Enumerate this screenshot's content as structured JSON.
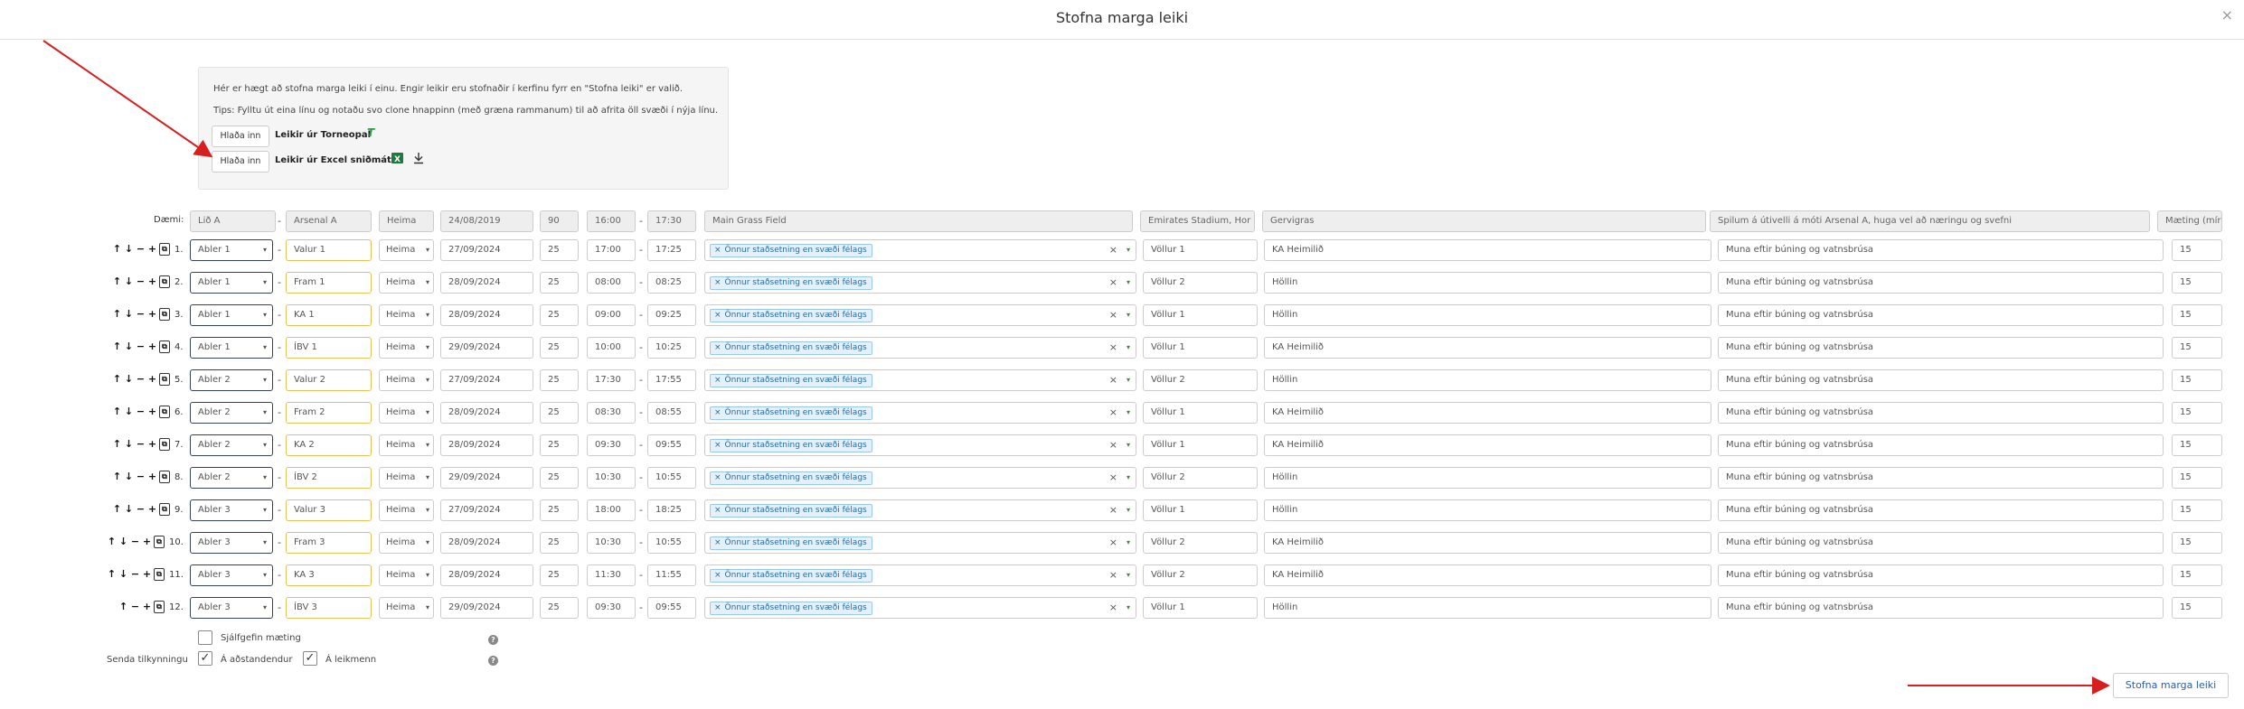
{
  "modal": {
    "title": "Stofna marga leiki",
    "close_icon": "×"
  },
  "info": {
    "line1": "Hér er hægt að stofna marga leiki í einu. Engir leikir eru stofnaðir í kerfinu fyrr en \"Stofna leiki\" er valið.",
    "line2": "Tips: Fylltu út eina línu og notaðu svo clone hnappinn (með græna rammanum) til að afrita öll svæði í nýja línu.",
    "load_button": "Hlaða inn",
    "load_torneopal": "Leikir úr Torneopal",
    "load_excel": "Leikir úr Excel sniðmáti",
    "torneopal_icon": "T",
    "excel_icon": "excel-icon",
    "download_icon": "download-icon"
  },
  "example": {
    "label": "Dæmi:",
    "team": "Lið A",
    "opponent": "Arsenal A",
    "venue": "Heima",
    "date": "24/08/2019",
    "duration": "90",
    "start": "16:00",
    "end": "17:30",
    "field": "Main Grass Field",
    "location": "Emirates Stadium, Hor",
    "surface": "Gervigras",
    "note": "Spilum á útivelli á móti Arsenal A, huga vel að næringu og svefni",
    "meet": "Mæting (mír"
  },
  "dash": "-",
  "field_tag": "Önnur staðsetning en svæði félags",
  "rows": [
    {
      "num": "1.",
      "team": "Abler 1",
      "opponent": "Valur 1",
      "venue": "Heima",
      "date": "27/09/2024",
      "duration": "25",
      "start": "17:00",
      "end": "17:25",
      "location": "Völlur 1",
      "surface": "KA Heimilið",
      "note": "Muna eftir búning og vatnsbrúsa",
      "meet": "15"
    },
    {
      "num": "2.",
      "team": "Abler 1",
      "opponent": "Fram 1",
      "venue": "Heima",
      "date": "28/09/2024",
      "duration": "25",
      "start": "08:00",
      "end": "08:25",
      "location": "Völlur 2",
      "surface": "Höllin",
      "note": "Muna eftir búning og vatnsbrúsa",
      "meet": "15"
    },
    {
      "num": "3.",
      "team": "Abler 1",
      "opponent": "KA 1",
      "venue": "Heima",
      "date": "28/09/2024",
      "duration": "25",
      "start": "09:00",
      "end": "09:25",
      "location": "Völlur 1",
      "surface": "Höllin",
      "note": "Muna eftir búning og vatnsbrúsa",
      "meet": "15"
    },
    {
      "num": "4.",
      "team": "Abler 1",
      "opponent": "ÍBV 1",
      "venue": "Heima",
      "date": "29/09/2024",
      "duration": "25",
      "start": "10:00",
      "end": "10:25",
      "location": "Völlur 1",
      "surface": "KA Heimilið",
      "note": "Muna eftir búning og vatnsbrúsa",
      "meet": "15"
    },
    {
      "num": "5.",
      "team": "Abler 2",
      "opponent": "Valur 2",
      "venue": "Heima",
      "date": "27/09/2024",
      "duration": "25",
      "start": "17:30",
      "end": "17:55",
      "location": "Völlur 2",
      "surface": "Höllin",
      "note": "Muna eftir búning og vatnsbrúsa",
      "meet": "15"
    },
    {
      "num": "6.",
      "team": "Abler 2",
      "opponent": "Fram 2",
      "venue": "Heima",
      "date": "28/09/2024",
      "duration": "25",
      "start": "08:30",
      "end": "08:55",
      "location": "Völlur 1",
      "surface": "KA Heimilið",
      "note": "Muna eftir búning og vatnsbrúsa",
      "meet": "15"
    },
    {
      "num": "7.",
      "team": "Abler 2",
      "opponent": "KA 2",
      "venue": "Heima",
      "date": "28/09/2024",
      "duration": "25",
      "start": "09:30",
      "end": "09:55",
      "location": "Völlur 1",
      "surface": "KA Heimilið",
      "note": "Muna eftir búning og vatnsbrúsa",
      "meet": "15"
    },
    {
      "num": "8.",
      "team": "Abler 2",
      "opponent": "ÍBV 2",
      "venue": "Heima",
      "date": "29/09/2024",
      "duration": "25",
      "start": "10:30",
      "end": "10:55",
      "location": "Völlur 2",
      "surface": "Höllin",
      "note": "Muna eftir búning og vatnsbrúsa",
      "meet": "15"
    },
    {
      "num": "9.",
      "team": "Abler 3",
      "opponent": "Valur 3",
      "venue": "Heima",
      "date": "27/09/2024",
      "duration": "25",
      "start": "18:00",
      "end": "18:25",
      "location": "Völlur 1",
      "surface": "Höllin",
      "note": "Muna eftir búning og vatnsbrúsa",
      "meet": "15"
    },
    {
      "num": "10.",
      "team": "Abler 3",
      "opponent": "Fram 3",
      "venue": "Heima",
      "date": "28/09/2024",
      "duration": "25",
      "start": "10:30",
      "end": "10:55",
      "location": "Völlur 2",
      "surface": "KA Heimilið",
      "note": "Muna eftir búning og vatnsbrúsa",
      "meet": "15"
    },
    {
      "num": "11.",
      "team": "Abler 3",
      "opponent": "KA 3",
      "venue": "Heima",
      "date": "28/09/2024",
      "duration": "25",
      "start": "11:30",
      "end": "11:55",
      "location": "Völlur 2",
      "surface": "KA Heimilið",
      "note": "Muna eftir búning og vatnsbrúsa",
      "meet": "15"
    },
    {
      "num": "12.",
      "team": "Abler 3",
      "opponent": "ÍBV 3",
      "venue": "Heima",
      "date": "29/09/2024",
      "duration": "25",
      "start": "09:30",
      "end": "09:55",
      "location": "Völlur 1",
      "surface": "Höllin",
      "note": "Muna eftir búning og vatnsbrúsa",
      "meet": "15"
    }
  ],
  "row_controls": {
    "up": "↑",
    "down": "↓",
    "remove": "−",
    "add": "+",
    "clone": "⧉"
  },
  "options": {
    "default_meet_label": "Sjálfgefin mæting",
    "send_notification_label": "Senda tilkynningu",
    "guardians_label": "Á aðstandendur",
    "players_label": "Á leikmenn",
    "help_glyph": "?"
  },
  "submit_label": "Stofna marga leiki",
  "annotation_color": "#d62020"
}
